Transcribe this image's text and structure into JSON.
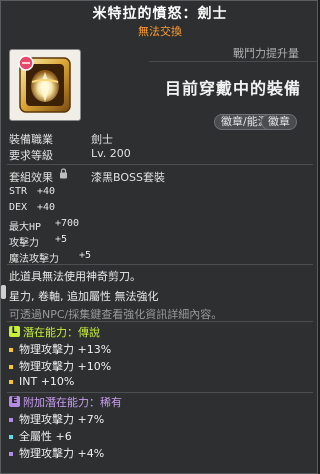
{
  "header": {
    "title": "米特拉的憤怒：劍士",
    "subtitle": "無法交換"
  },
  "power": {
    "caption": "戰鬥力提升量",
    "status": "目前穿戴中的裝備"
  },
  "tags": [
    "徽章/能源",
    "徽章"
  ],
  "info": {
    "job_label": "裝備職業",
    "job_value": "劍士",
    "level_label": "要求等級",
    "level_value": "Lv. 200"
  },
  "set": {
    "label": "套組效果",
    "name": "漆黑BOSS套裝"
  },
  "stats": [
    {
      "name": "STR",
      "value": "+40"
    },
    {
      "name": "DEX",
      "value": "+40"
    },
    {
      "name": "最大HP",
      "value": "+700"
    },
    {
      "name": "攻擊力",
      "value": "+5"
    },
    {
      "name": "魔法攻擊力",
      "value": "+5"
    }
  ],
  "notes": {
    "scissors": "此道具無法使用神奇剪刀。",
    "enhance": "星力, 卷軸, 追加屬性 無法強化",
    "hint": "可透過NPC/採集鍵查看強化資訊詳細內容。"
  },
  "potential": {
    "badge": "L",
    "label": "潛在能力",
    "sep": "：",
    "grade": "傳說",
    "lines": [
      "物理攻擊力 +13%",
      "物理攻擊力 +10%",
      "INT +10%"
    ]
  },
  "additional": {
    "badge": "E",
    "label": "附加潛在能力",
    "sep": "：",
    "grade": "稀有",
    "lines": [
      "物理攻擊力 +7%",
      "全屬性 +6",
      "物理攻擊力 +4%"
    ]
  },
  "colors": {
    "potential_badge": "#c6f03a",
    "potential_grade": "#c6f03a",
    "additional_badge": "#b58be8",
    "additional_grade": "#c89cf0",
    "bullet_potential": "#f7c52c",
    "bullet_additional": "#b58be8",
    "bullet_additional_cyan": "#62d8e8",
    "untradeable": "#ff9d2e"
  },
  "icons": [
    "emblem-icon",
    "lock-icon"
  ]
}
